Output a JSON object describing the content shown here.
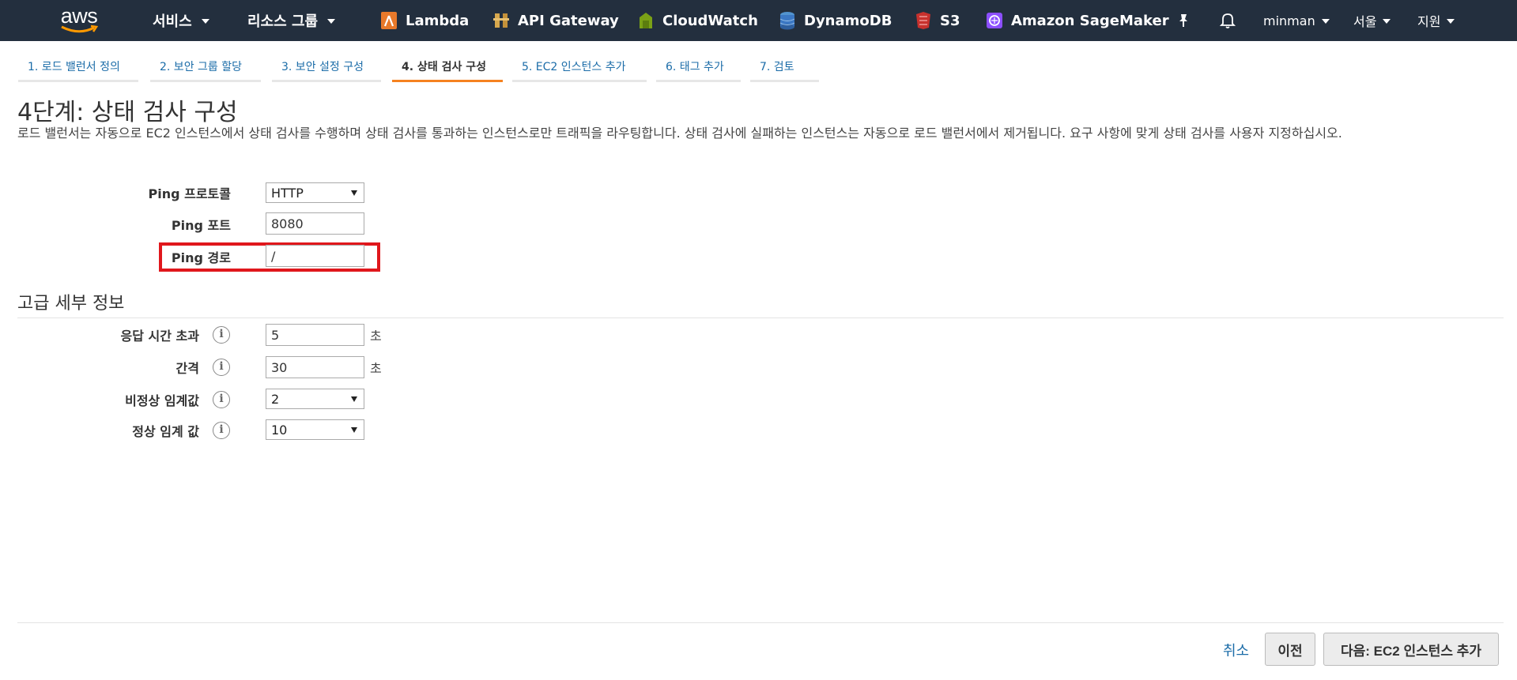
{
  "header": {
    "logo_text": "aws",
    "services_label": "서비스",
    "resource_groups_label": "리소스 그룹",
    "services": [
      {
        "label": "Lambda",
        "icon": "lambda-icon",
        "color": "#e8792a"
      },
      {
        "label": "API Gateway",
        "icon": "api-gateway-icon",
        "color": "#d7a84d"
      },
      {
        "label": "CloudWatch",
        "icon": "cloudwatch-icon",
        "color": "#7aa116"
      },
      {
        "label": "DynamoDB",
        "icon": "dynamodb-icon",
        "color": "#3b78c4"
      },
      {
        "label": "S3",
        "icon": "s3-icon",
        "color": "#c8312d"
      },
      {
        "label": "Amazon SageMaker",
        "icon": "sagemaker-icon",
        "color": "#8c4fff"
      }
    ],
    "user_label": "minman",
    "region_label": "서울",
    "support_label": "지원",
    "colors": {
      "bar": "#232f3e",
      "accent": "#f58220"
    }
  },
  "wizard": {
    "tabs": [
      {
        "label": "1. 로드 밸런서 정의",
        "active": false
      },
      {
        "label": "2. 보안 그룹 할당",
        "active": false
      },
      {
        "label": "3. 보안 설정 구성",
        "active": false
      },
      {
        "label": "4. 상태 검사 구성",
        "active": true
      },
      {
        "label": "5. EC2 인스턴스 추가",
        "active": false
      },
      {
        "label": "6. 태그 추가",
        "active": false
      },
      {
        "label": "7. 검토",
        "active": false
      }
    ]
  },
  "page": {
    "title": "4단계: 상태 검사 구성",
    "description": "로드 밸런서는 자동으로 EC2 인스턴스에서 상태 검사를 수행하며 상태 검사를 통과하는 인스턴스로만 트래픽을 라우팅합니다. 상태 검사에 실패하는 인스턴스는 자동으로 로드 밸런서에서 제거됩니다. 요구 사항에 맞게 상태 검사를 사용자 지정하십시오."
  },
  "ping": {
    "protocol_label": "Ping 프로토콜",
    "protocol_value": "HTTP",
    "port_label": "Ping 포트",
    "port_value": "8080",
    "path_label": "Ping 경로",
    "path_value": "/"
  },
  "advanced": {
    "title": "고급 세부 정보",
    "response_timeout_label": "응답 시간 초과",
    "response_timeout_value": "5",
    "response_timeout_unit": "초",
    "interval_label": "간격",
    "interval_value": "30",
    "interval_unit": "초",
    "unhealthy_threshold_label": "비정상 임계값",
    "unhealthy_threshold_value": "2",
    "healthy_threshold_label": "정상 임계 값",
    "healthy_threshold_value": "10"
  },
  "footer": {
    "cancel_label": "취소",
    "previous_label": "이전",
    "next_label": "다음: EC2 인스턴스 추가"
  }
}
